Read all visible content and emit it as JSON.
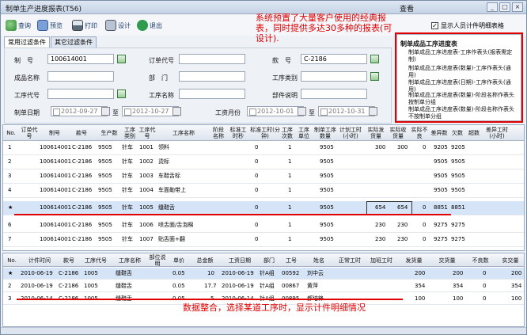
{
  "window": {
    "title": "制单生产进度报表(T56)",
    "center_label": "查看",
    "controls": [
      "_",
      "□",
      "×"
    ]
  },
  "toolbar": {
    "query": "查询",
    "preview": "预览",
    "print": "打印",
    "design": "设计",
    "exit": "退出"
  },
  "annotations": {
    "top": "系统预置了大量客户使用的经典报表，同时提供多达30多种的报表(可设计).",
    "bottom": "数据整合，选择某道工序时，显示计件明细情况"
  },
  "show_detail_checkbox": {
    "label": "显示人员计件明细表格",
    "checked": true
  },
  "tabs": [
    "常用过滤条件",
    "其它过滤条件"
  ],
  "filter": {
    "order_no_label": "制　号",
    "order_no_value": "100614001",
    "order_code_label": "订单代号",
    "order_code_value": "",
    "style_label": "款　号",
    "style_value": "C-2186",
    "color_label": "成品名称",
    "color_value": "",
    "dept_label": "部　门",
    "dept_value": "",
    "proc_type_label": "工序类别",
    "proc_type_value": "",
    "proc_code_label": "工序代号",
    "proc_code_value": "",
    "proc_name_label": "工序名称",
    "proc_name_value": "",
    "part_label": "部件说明",
    "part_value": "",
    "date_label": "制单日期",
    "date_from": "2012-09-27",
    "to1": "至",
    "date_to": "2012-10-27",
    "wage_label": "工资月份",
    "wage_from": "2012-10-01",
    "to2": "至",
    "wage_to": "2012-10-31"
  },
  "tree": {
    "root": "制单成品工序进度表",
    "items": [
      "制单成品工序进度表-工序作表头(报表需定制)",
      "制单成品工序进度表(数量)-工序作表头(通用)",
      "制单成品工序进度表(日期)-工序作表头(通用)",
      "制单成品工序进度表(数量)-阶段名称作表头按制单分组",
      "制单成品工序进度表(数量)-阶段名称作表头不按制单分组"
    ]
  },
  "grid1": {
    "headers": [
      "No.",
      "订单代号",
      "制号",
      "款号",
      "生产数",
      "工序类别",
      "工序代号",
      "工序名称",
      "阶段名称",
      "标准工时秒",
      "标准工时(分钟)",
      "工序次数",
      "工序单位",
      "制单工序数量",
      "计划工时(小时)",
      "实际发货量",
      "实际收货量",
      "实际不良",
      "差异数",
      "欠数",
      "超数",
      "差异工时(小时)"
    ],
    "rows": [
      {
        "no": "1",
        "zh": "100614001",
        "kh": "C-2186",
        "qty": "9505",
        "ptype": "针车",
        "pcode": "1001",
        "pname": "领料",
        "std": "0",
        "times": "1",
        "pqty": "9505",
        "send": "300",
        "recv": "300",
        "bad": "0",
        "diff": "9205",
        "owe": "9205"
      },
      {
        "no": "2",
        "zh": "100614001",
        "kh": "C-2186",
        "qty": "9505",
        "ptype": "针车",
        "pcode": "1002",
        "pname": "烫标",
        "std": "0",
        "times": "1",
        "pqty": "9505",
        "send": "",
        "recv": "",
        "bad": "",
        "diff": "9505",
        "owe": "9505"
      },
      {
        "no": "3",
        "zh": "100614001",
        "kh": "C-2186",
        "qty": "9505",
        "ptype": "针车",
        "pcode": "1003",
        "pname": "车鞋舌标",
        "std": "0",
        "times": "1",
        "pqty": "9505",
        "send": "",
        "recv": "",
        "bad": "",
        "diff": "9505",
        "owe": "9505"
      },
      {
        "no": "4",
        "zh": "100614001",
        "kh": "C-2186",
        "qty": "9505",
        "ptype": "针车",
        "pcode": "1004",
        "pname": "车面勒带上",
        "std": "0",
        "times": "1",
        "pqty": "9505",
        "send": "",
        "recv": "",
        "bad": "",
        "diff": "9505",
        "owe": "9505"
      },
      {
        "no": "★",
        "zh": "100614001",
        "kh": "C-2186",
        "qty": "9505",
        "ptype": "针车",
        "pcode": "1005",
        "pname": "缝鞋舌",
        "std": "0",
        "times": "1",
        "pqty": "9505",
        "send": "654",
        "recv": "654",
        "bad": "0",
        "diff": "8851",
        "owe": "8851"
      },
      {
        "no": "6",
        "zh": "100614001",
        "kh": "C-2186",
        "qty": "9505",
        "ptype": "针车",
        "pcode": "1006",
        "pname": "喷舌面/舌泡棉",
        "std": "0",
        "times": "1",
        "pqty": "9505",
        "send": "230",
        "recv": "230",
        "bad": "0",
        "diff": "9275",
        "owe": "9275"
      },
      {
        "no": "7",
        "zh": "100614001",
        "kh": "C-2186",
        "qty": "9505",
        "ptype": "针车",
        "pcode": "1007",
        "pname": "贴舌面+翻",
        "std": "0",
        "times": "1",
        "pqty": "9505",
        "send": "230",
        "recv": "230",
        "bad": "0",
        "diff": "9275",
        "owe": "9275"
      }
    ]
  },
  "grid2": {
    "headers": [
      "No.",
      "计件时间",
      "款号",
      "工序代号",
      "工序名称",
      "部位说明",
      "单价",
      "总金额",
      "工资日期",
      "部门",
      "工号",
      "姓名",
      "正常工时",
      "加班工时",
      "发货量",
      "交货量",
      "不良数",
      "实交量"
    ],
    "rows": [
      {
        "no": "★",
        "date": "2010-06-19",
        "kh": "C-2186",
        "pcode": "1005",
        "pname": "缝鞋舌",
        "price": "0.05",
        "amount": "10",
        "wdate": "2010-06-19",
        "dept": "针A组",
        "id": "00592",
        "name": "刘中云",
        "out": "200",
        "in": "200",
        "bad": "0",
        "real": "200"
      },
      {
        "no": "2",
        "date": "2010-06-19",
        "kh": "C-2186",
        "pcode": "1005",
        "pname": "缝鞋舌",
        "price": "0.05",
        "amount": "17.7",
        "wdate": "2010-06-19",
        "dept": "针A组",
        "id": "00867",
        "name": "黄萍",
        "out": "354",
        "in": "354",
        "bad": "0",
        "real": "354"
      },
      {
        "no": "3",
        "date": "2010-06-14",
        "kh": "C-2186",
        "pcode": "1005",
        "pname": "缝鞋舌",
        "price": "0.05",
        "amount": "5",
        "wdate": "2010-06-14",
        "dept": "针A组",
        "id": "00895",
        "name": "郝培锋",
        "out": "100",
        "in": "100",
        "bad": "0",
        "real": "100"
      }
    ]
  }
}
